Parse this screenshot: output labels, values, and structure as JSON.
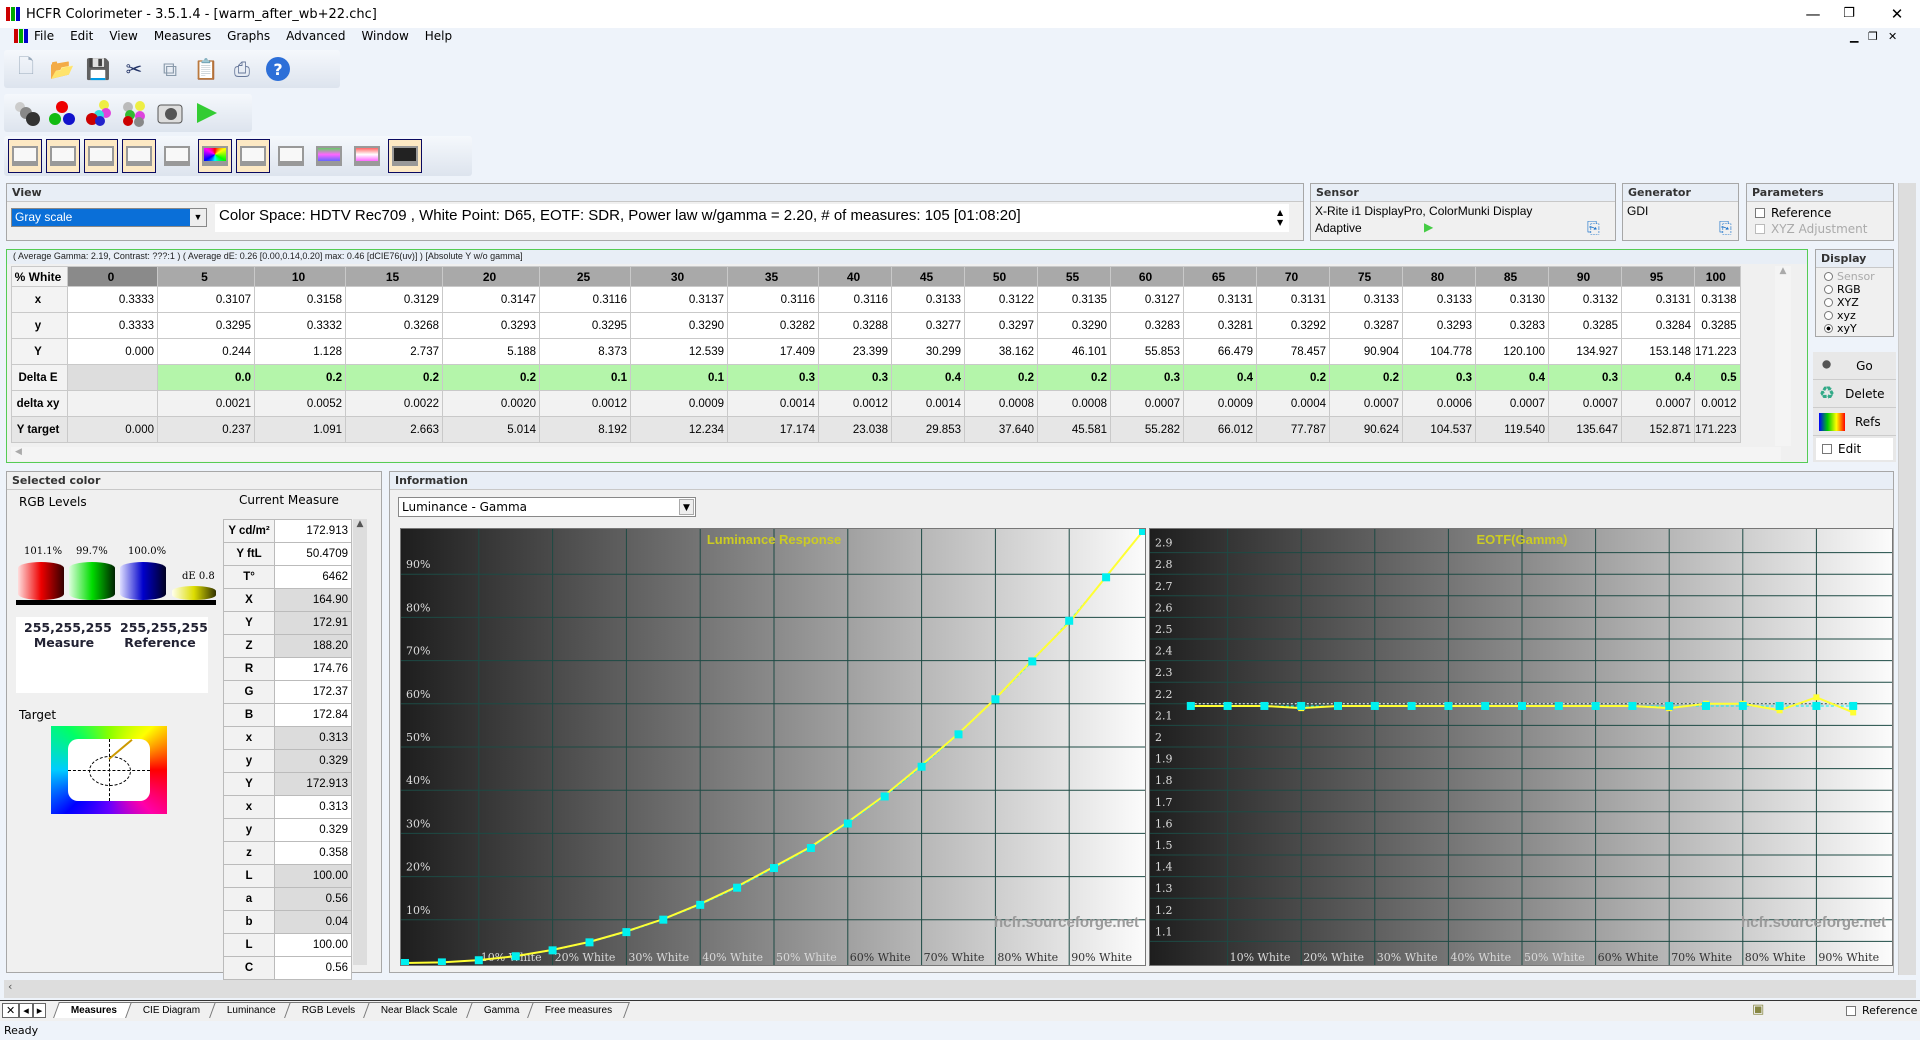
{
  "app": {
    "title": "HCFR Colorimeter - 3.5.1.4 - [warm_after_wb+22.chc]"
  },
  "menu": [
    "File",
    "Edit",
    "View",
    "Measures",
    "Graphs",
    "Advanced",
    "Window",
    "Help"
  ],
  "toolbar1": [
    "new-icon",
    "open-icon",
    "save-icon",
    "cut-icon",
    "copy-icon",
    "paste-icon",
    "print-icon",
    "help-icon"
  ],
  "toolbar2": [
    "grayscale-measure-icon",
    "primaries-icon",
    "secondaries-icon",
    "all-colors-icon",
    "camera-icon",
    "play-icon"
  ],
  "toolbar3": [
    "measures-view",
    "luminance-view",
    "gamma-view",
    "rgb-levels-view",
    "near-black-view",
    "cie-diagram-view",
    "near-white-view",
    "saturation-view",
    "color-temp-view",
    "color-levels-view",
    "free-measures-view"
  ],
  "view": {
    "title": "View",
    "selected": "Gray scale",
    "info": "Color Space: HDTV Rec709 , White Point: D65, EOTF:  SDR, Power law w/gamma = 2.20, # of measures: 105 [01:08:20]"
  },
  "sensor": {
    "title": "Sensor",
    "name": "X-Rite i1 DisplayPro, ColorMunki Display",
    "mode": "Adaptive"
  },
  "generator": {
    "title": "Generator",
    "name": "GDI"
  },
  "parameters": {
    "title": "Parameters",
    "reference": "Reference",
    "xyz_adjustment": "XYZ Adjustment"
  },
  "table": {
    "summary": "( Average Gamma: 2.19, Contrast: ???:1 ) ( Average dE: 0.26 [0.00,0.14,0.20] max: 0.46 [dCIE76(uv)] ) [Absolute Y w/o gamma]",
    "corner": "% White",
    "columns": [
      "0",
      "5",
      "10",
      "15",
      "20",
      "25",
      "30",
      "35",
      "40",
      "45",
      "50",
      "55",
      "60",
      "65",
      "70",
      "75",
      "80",
      "85",
      "90",
      "95",
      "100"
    ],
    "rows": [
      {
        "label": "x",
        "values": [
          "0.3333",
          "0.3107",
          "0.3158",
          "0.3129",
          "0.3147",
          "0.3116",
          "0.3137",
          "0.3116",
          "0.3116",
          "0.3133",
          "0.3122",
          "0.3135",
          "0.3127",
          "0.3131",
          "0.3131",
          "0.3133",
          "0.3133",
          "0.3130",
          "0.3132",
          "0.3131",
          "0.3138"
        ]
      },
      {
        "label": "y",
        "values": [
          "0.3333",
          "0.3295",
          "0.3332",
          "0.3268",
          "0.3293",
          "0.3295",
          "0.3290",
          "0.3282",
          "0.3288",
          "0.3277",
          "0.3297",
          "0.3290",
          "0.3283",
          "0.3281",
          "0.3292",
          "0.3287",
          "0.3293",
          "0.3283",
          "0.3285",
          "0.3284",
          "0.3285"
        ]
      },
      {
        "label": "Y",
        "values": [
          "0.000",
          "0.244",
          "1.128",
          "2.737",
          "5.188",
          "8.373",
          "12.539",
          "17.409",
          "23.399",
          "30.299",
          "38.162",
          "46.101",
          "55.853",
          "66.479",
          "78.457",
          "90.904",
          "104.778",
          "120.100",
          "134.927",
          "153.148",
          "171.223"
        ]
      },
      {
        "label": "Delta E",
        "values": [
          "",
          "0.0",
          "0.2",
          "0.2",
          "0.2",
          "0.1",
          "0.1",
          "0.3",
          "0.3",
          "0.4",
          "0.2",
          "0.2",
          "0.3",
          "0.4",
          "0.2",
          "0.2",
          "0.3",
          "0.4",
          "0.3",
          "0.4",
          "0.5"
        ]
      },
      {
        "label": "delta xy",
        "values": [
          "",
          "0.0021",
          "0.0052",
          "0.0022",
          "0.0020",
          "0.0012",
          "0.0009",
          "0.0014",
          "0.0012",
          "0.0014",
          "0.0008",
          "0.0008",
          "0.0007",
          "0.0009",
          "0.0004",
          "0.0007",
          "0.0006",
          "0.0007",
          "0.0007",
          "0.0007",
          "0.0012"
        ]
      },
      {
        "label": "Y target",
        "values": [
          "0.000",
          "0.237",
          "1.091",
          "2.663",
          "5.014",
          "8.192",
          "12.234",
          "17.174",
          "23.038",
          "29.853",
          "37.640",
          "45.581",
          "55.282",
          "66.012",
          "77.787",
          "90.624",
          "104.537",
          "119.540",
          "135.647",
          "152.871",
          "171.223"
        ]
      }
    ]
  },
  "display": {
    "title": "Display",
    "options": [
      "Sensor",
      "RGB",
      "XYZ",
      "xyz",
      "xyY"
    ],
    "selected": "xyY",
    "go": "Go",
    "delete": "Delete",
    "refs": "Refs",
    "edit": "Edit"
  },
  "selected_color": {
    "title": "Selected color",
    "rgb_levels": "RGB Levels",
    "levels": {
      "red": "101.1%",
      "green": "99.7%",
      "blue": "100.0%",
      "de": "dE 0.8"
    },
    "measure_rgb": "255,255,255",
    "measure_label": "Measure",
    "reference_rgb": "255,255,255",
    "reference_label": "Reference",
    "target": "Target",
    "current_measure": "Current Measure",
    "rows": [
      [
        "Y cd/m²",
        "172.913"
      ],
      [
        "Y ftL",
        "50.4709"
      ],
      [
        "T°",
        "6462"
      ],
      [
        "X",
        "164.90"
      ],
      [
        "Y",
        "172.91"
      ],
      [
        "Z",
        "188.20"
      ],
      [
        "R",
        "174.76"
      ],
      [
        "G",
        "172.37"
      ],
      [
        "B",
        "172.84"
      ],
      [
        "x",
        "0.313"
      ],
      [
        "y",
        "0.329"
      ],
      [
        "Y",
        "172.913"
      ],
      [
        "x",
        "0.313"
      ],
      [
        "y",
        "0.329"
      ],
      [
        "z",
        "0.358"
      ],
      [
        "L",
        "100.00"
      ],
      [
        "a",
        "0.56"
      ],
      [
        "b",
        "0.04"
      ],
      [
        "L",
        "100.00"
      ],
      [
        "C",
        "0.56"
      ]
    ]
  },
  "information": {
    "title": "Information",
    "graph_select": "Luminance - Gamma",
    "watermark": "hcfr.sourceforge.net"
  },
  "chart_data": [
    {
      "type": "line",
      "title": "Luminance Response",
      "ylim": [
        0,
        100
      ],
      "xlim": [
        0,
        100
      ],
      "x_tick_labels": [
        "10% White",
        "20% White",
        "30% White",
        "40% White",
        "50% White",
        "60% White",
        "70% White",
        "80% White",
        "90% White"
      ],
      "y_tick_labels": [
        "10%",
        "20%",
        "30%",
        "40%",
        "50%",
        "60%",
        "70%",
        "80%",
        "90%"
      ],
      "x": [
        0,
        5,
        10,
        15,
        20,
        25,
        30,
        35,
        40,
        45,
        50,
        55,
        60,
        65,
        70,
        75,
        80,
        85,
        90,
        95,
        100
      ],
      "series": [
        {
          "values": [
            0,
            0.14,
            0.66,
            1.6,
            3.03,
            4.89,
            7.32,
            10.17,
            13.67,
            17.7,
            22.29,
            26.92,
            32.62,
            38.83,
            45.82,
            53.09,
            61.19,
            70.14,
            78.8,
            89.44,
            100
          ],
          "color": "#ffff33"
        },
        {
          "values": [
            0,
            0.14,
            0.64,
            1.56,
            2.93,
            4.78,
            7.15,
            10.03,
            13.46,
            17.43,
            21.98,
            26.62,
            32.29,
            38.55,
            45.43,
            52.93,
            61.05,
            69.81,
            79.22,
            89.28,
            100
          ],
          "color": "#00f0f0"
        }
      ],
      "grid": true
    },
    {
      "type": "line",
      "title": "EOTF(Gamma)",
      "ylim": [
        1.0,
        3.0
      ],
      "xlim": [
        0,
        100
      ],
      "reference_gamma": 2.2,
      "x_tick_labels": [
        "10% White",
        "20% White",
        "30% White",
        "40% White",
        "50% White",
        "60% White",
        "70% White",
        "80% White",
        "90% White"
      ],
      "y_tick_labels": [
        "1.1",
        "1.2",
        "1.3",
        "1.4",
        "1.5",
        "1.6",
        "1.7",
        "1.8",
        "1.9",
        "2",
        "2.1",
        "2.2",
        "2.3",
        "2.4",
        "2.5",
        "2.6",
        "2.7",
        "2.8",
        "2.9"
      ],
      "x": [
        5,
        10,
        15,
        20,
        25,
        30,
        35,
        40,
        45,
        50,
        55,
        60,
        65,
        70,
        75,
        80,
        85,
        90,
        95
      ],
      "series": [
        {
          "values": [
            2.19,
            2.19,
            2.19,
            2.18,
            2.19,
            2.19,
            2.19,
            2.19,
            2.19,
            2.19,
            2.19,
            2.19,
            2.19,
            2.18,
            2.2,
            2.2,
            2.17,
            2.23,
            2.16
          ],
          "color": "#ffff33"
        },
        {
          "values": [
            2.19,
            2.19,
            2.19,
            2.19,
            2.19,
            2.19,
            2.19,
            2.19,
            2.19,
            2.19,
            2.19,
            2.19,
            2.19,
            2.19,
            2.19,
            2.19,
            2.19,
            2.19,
            2.19
          ],
          "color": "#00f0f0"
        }
      ],
      "grid": true
    }
  ],
  "tabs": [
    "Measures",
    "CIE Diagram",
    "Luminance",
    "RGB Levels",
    "Near Black Scale",
    "Gamma",
    "Free measures"
  ],
  "active_tab": "Measures",
  "statusbar": {
    "text": "Ready",
    "reference": "Reference"
  }
}
